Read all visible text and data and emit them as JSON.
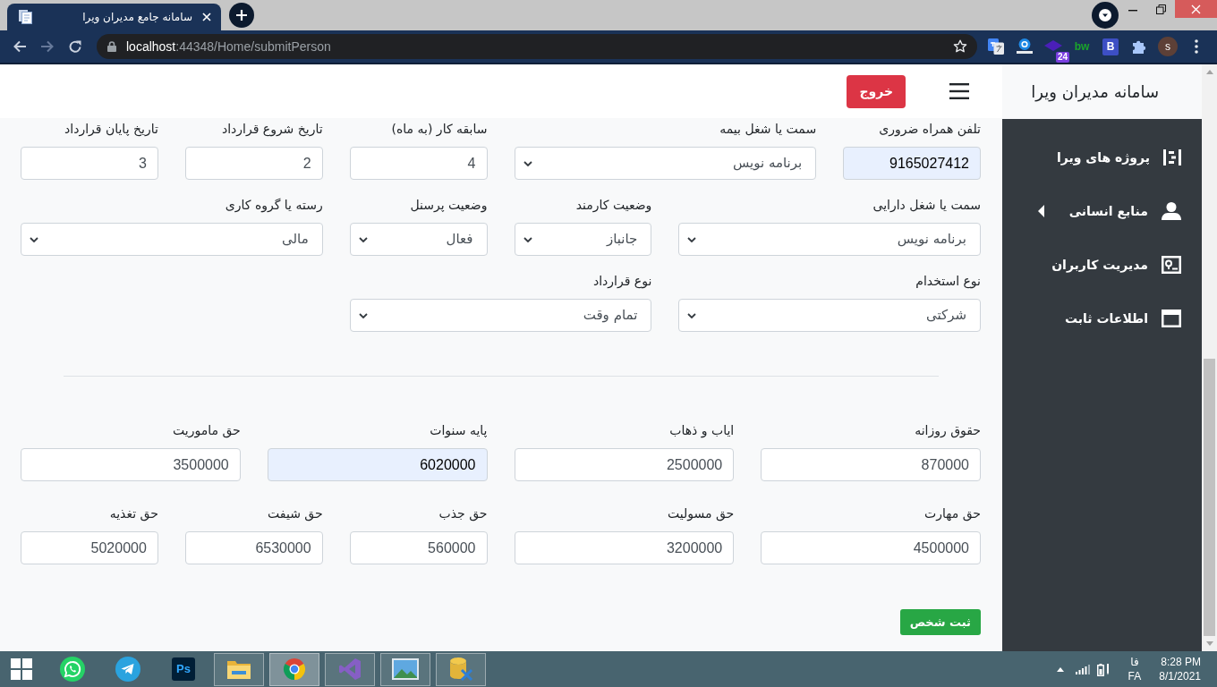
{
  "browser": {
    "tab_title": "سامانه جامع مدیران ویرا",
    "url_host": "localhost",
    "url_path": ":44348/Home/submitPerson",
    "extensions": [
      {
        "kind": "translate"
      },
      {
        "kind": "reader"
      },
      {
        "kind": "badge",
        "text": "24"
      },
      {
        "kind": "word",
        "text": "bw"
      },
      {
        "kind": "tile",
        "text": "B"
      },
      {
        "kind": "puzzle"
      }
    ],
    "profile_initial": "s"
  },
  "header": {
    "exit_button": "خروج"
  },
  "form": {
    "sections": [
      {
        "rows": [
          [
            {
              "label": "تلفن همراه ضروری",
              "kind": "input",
              "value": "9165027412",
              "autofilled": true
            },
            {
              "label": "سمت یا شغل بیمه",
              "kind": "select",
              "value": "برنامه نویس",
              "autofilled": false
            },
            {
              "label": "سابقه کار (به ماه)",
              "kind": "input",
              "value": "4",
              "autofilled": false
            },
            {
              "label": "تاریخ شروع قرارداد",
              "kind": "input",
              "value": "2",
              "autofilled": false
            },
            {
              "label": "تاریخ پایان قرارداد",
              "kind": "input",
              "value": "3",
              "autofilled": false
            }
          ],
          [
            {
              "label": "سمت یا شغل دارایی",
              "kind": "select",
              "value": "برنامه نویس",
              "autofilled": false
            },
            {
              "label": "وضعیت کارمند",
              "kind": "select",
              "value": "جانباز",
              "autofilled": false
            },
            {
              "label": "وضعیت پرسنل",
              "kind": "select",
              "value": "فعال",
              "autofilled": false
            },
            {
              "label": "رسته یا گروه کاری",
              "kind": "select",
              "value": "مالی",
              "autofilled": false
            }
          ],
          [
            {
              "label": "نوع استخدام",
              "kind": "select",
              "value": "شرکتی",
              "autofilled": false
            },
            {
              "label": "نوع قرارداد",
              "kind": "select",
              "value": "تمام وقت",
              "autofilled": false
            }
          ]
        ]
      },
      {
        "rows": [
          [
            {
              "label": "حقوق روزانه",
              "kind": "input",
              "value": "870000",
              "autofilled": false
            },
            {
              "label": "ایاب و ذهاب",
              "kind": "input",
              "value": "2500000",
              "autofilled": false
            },
            {
              "label": "پایه سنوات",
              "kind": "input",
              "value": "6020000",
              "autofilled": true
            },
            {
              "label": "حق ماموریت",
              "kind": "input",
              "value": "3500000",
              "autofilled": false
            }
          ],
          [
            {
              "label": "حق مهارت",
              "kind": "input",
              "value": "4500000",
              "autofilled": false
            },
            {
              "label": "حق مسولیت",
              "kind": "input",
              "value": "3200000",
              "autofilled": false
            },
            {
              "label": "حق جذب",
              "kind": "input",
              "value": "560000",
              "autofilled": false
            },
            {
              "label": "حق شیفت",
              "kind": "input",
              "value": "6530000",
              "autofilled": false
            },
            {
              "label": "حق تغذیه",
              "kind": "input",
              "value": "5020000",
              "autofilled": false
            }
          ]
        ]
      }
    ],
    "submit_button": "ثبت شخص"
  },
  "sidebar": {
    "title": "سامانه مدیران ویرا",
    "items": [
      {
        "label": "پروژه های ویرا",
        "kind": "projects"
      },
      {
        "label": "منابع انسانی",
        "kind": "person",
        "expanded": false
      },
      {
        "label": "مدیریت کاربران",
        "kind": "card"
      },
      {
        "label": "اطلاعات ثابت",
        "kind": "window"
      }
    ]
  },
  "taskbar": {
    "apps": [
      {
        "kind": "chat",
        "running": false,
        "selected": false
      },
      {
        "kind": "plane",
        "running": false,
        "selected": false
      },
      {
        "kind": "ps",
        "text": "Ps",
        "running": false,
        "selected": false
      },
      {
        "kind": "folder",
        "running": true,
        "selected": false
      },
      {
        "kind": "browser",
        "running": true,
        "selected": true
      },
      {
        "kind": "studio",
        "running": true,
        "selected": false
      },
      {
        "kind": "photo",
        "running": true,
        "selected": false
      },
      {
        "kind": "database",
        "running": true,
        "selected": false
      }
    ],
    "language": "فا",
    "language_code": "FA",
    "time": "8:28 PM",
    "date": "8/1/2021"
  }
}
